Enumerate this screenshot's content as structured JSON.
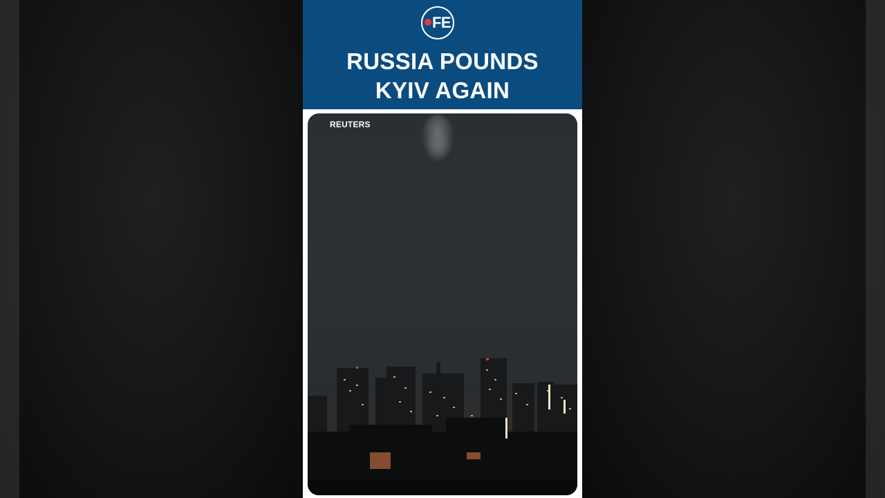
{
  "brand": {
    "logo_text": "FE",
    "accent_color": "#e8344a",
    "header_color": "#0b4c80"
  },
  "headline": {
    "line1": "RUSSIA POUNDS",
    "line2": "KYIV AGAIN"
  },
  "video": {
    "watermark": "REUTERS"
  }
}
